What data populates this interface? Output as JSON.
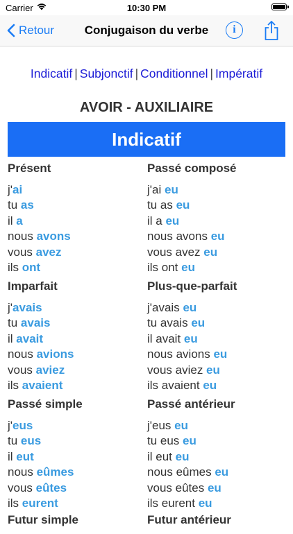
{
  "status_bar": {
    "carrier": "Carrier",
    "time": "10:30 PM"
  },
  "nav": {
    "back_label": "Retour",
    "title": "Conjugaison du verbe",
    "info_label": "i",
    "accent_color": "#1a7cf5"
  },
  "mood_links": [
    "Indicatif",
    "Subjonctif",
    "Conditionnel",
    "Impératif"
  ],
  "verb_title": "AVOIR - AUXILIAIRE",
  "mood_header": "Indicatif",
  "tenses": [
    {
      "name": "Présent",
      "rows": [
        {
          "stem": "j'",
          "end": "ai"
        },
        {
          "stem": "tu ",
          "end": "as"
        },
        {
          "stem": "il ",
          "end": "a"
        },
        {
          "stem": "nous ",
          "end": "avons"
        },
        {
          "stem": "vous ",
          "end": "avez"
        },
        {
          "stem": "ils ",
          "end": "ont"
        }
      ]
    },
    {
      "name": "Passé composé",
      "rows": [
        {
          "stem": "j'ai ",
          "end": "eu"
        },
        {
          "stem": "tu as ",
          "end": "eu"
        },
        {
          "stem": "il a ",
          "end": "eu"
        },
        {
          "stem": "nous avons ",
          "end": "eu"
        },
        {
          "stem": "vous avez ",
          "end": "eu"
        },
        {
          "stem": "ils ont ",
          "end": "eu"
        }
      ]
    },
    {
      "name": "Imparfait",
      "rows": [
        {
          "stem": "j'",
          "end": "avais"
        },
        {
          "stem": "tu ",
          "end": "avais"
        },
        {
          "stem": "il ",
          "end": "avait"
        },
        {
          "stem": "nous ",
          "end": "avions"
        },
        {
          "stem": "vous ",
          "end": "aviez"
        },
        {
          "stem": "ils ",
          "end": "avaient"
        }
      ]
    },
    {
      "name": "Plus-que-parfait",
      "rows": [
        {
          "stem": "j'avais ",
          "end": "eu"
        },
        {
          "stem": "tu avais ",
          "end": "eu"
        },
        {
          "stem": "il avait ",
          "end": "eu"
        },
        {
          "stem": "nous avions ",
          "end": "eu"
        },
        {
          "stem": "vous aviez ",
          "end": "eu"
        },
        {
          "stem": "ils avaient ",
          "end": "eu"
        }
      ]
    },
    {
      "name": "Passé simple",
      "rows": [
        {
          "stem": "j'",
          "end": "eus"
        },
        {
          "stem": "tu ",
          "end": "eus"
        },
        {
          "stem": "il ",
          "end": "eut"
        },
        {
          "stem": "nous ",
          "end": "eûmes"
        },
        {
          "stem": "vous ",
          "end": "eûtes"
        },
        {
          "stem": "ils ",
          "end": "eurent"
        }
      ]
    },
    {
      "name": "Passé antérieur",
      "rows": [
        {
          "stem": "j'eus ",
          "end": "eu"
        },
        {
          "stem": "tu eus ",
          "end": "eu"
        },
        {
          "stem": "il eut ",
          "end": "eu"
        },
        {
          "stem": "nous eûmes ",
          "end": "eu"
        },
        {
          "stem": "vous eûtes ",
          "end": "eu"
        },
        {
          "stem": "ils eurent ",
          "end": "eu"
        }
      ]
    },
    {
      "name": "Futur simple",
      "rows": []
    },
    {
      "name": "Futur antérieur",
      "rows": []
    }
  ]
}
